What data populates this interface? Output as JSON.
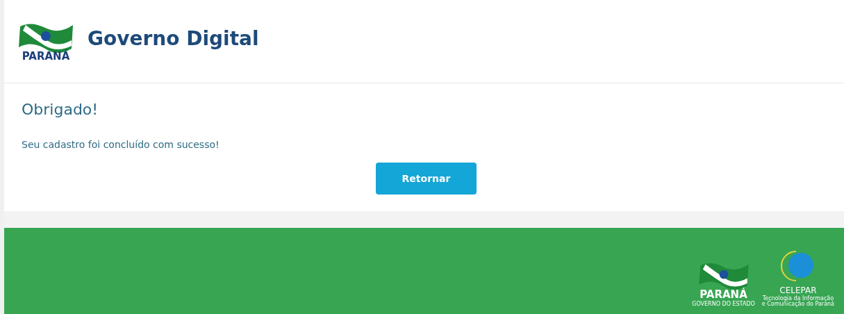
{
  "header": {
    "logo_text": "PARANÁ",
    "title": "Governo Digital"
  },
  "content": {
    "heading": "Obrigado!",
    "message": "Seu cadastro foi concluído com sucesso!",
    "button": "Retornar"
  },
  "footer": {
    "state_logo": {
      "name": "PARANÁ",
      "subtitle": "GOVERNO DO ESTADO"
    },
    "celepar_logo": {
      "name": "CELEPAR",
      "tagline_1": "Tecnologia da Informação",
      "tagline_2": "e Comunicação do Paraná"
    }
  }
}
